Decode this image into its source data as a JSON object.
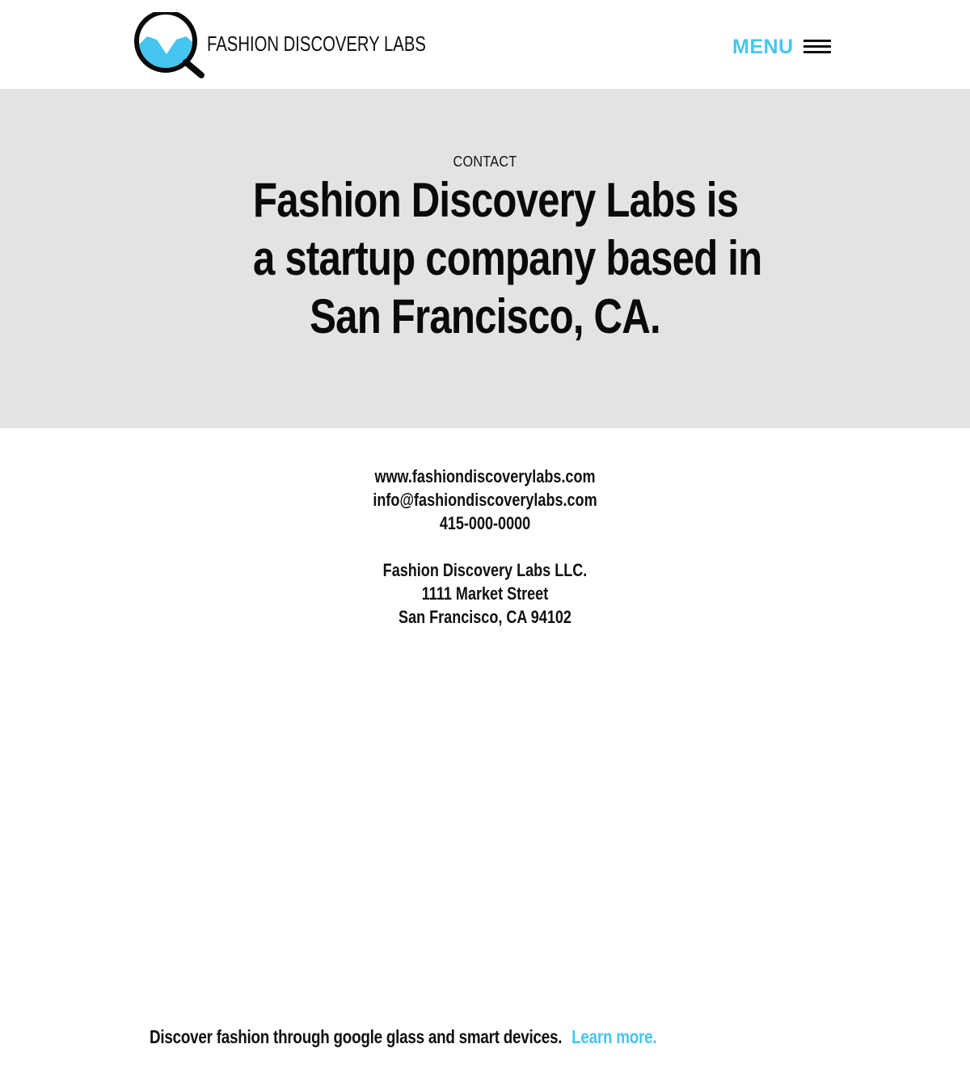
{
  "header": {
    "logo_text": "FASHION DISCOVERY LABS",
    "menu_label": "MENU"
  },
  "hero": {
    "eyebrow": "CONTACT",
    "headline_lines": [
      "Fashion Discovery Labs is",
      "a startup company based in",
      "San Francisco, CA."
    ]
  },
  "contact": {
    "website": "www.fashiondiscoverylabs.com",
    "email": "info@fashiondiscoverylabs.com",
    "phone": "415-000-0000",
    "company": "Fashion Discovery Labs LLC.",
    "street": "1111 Market Street",
    "city": "San Francisco, CA 94102"
  },
  "footer": {
    "tagline": "Discover fashion through google glass and smart devices.",
    "learn_more": "Learn more."
  },
  "colors": {
    "accent": "#45c6f0",
    "hero_bg": "#e3e3e3",
    "text": "#111111"
  },
  "icons": {
    "logo_mark": "magnifier-shirt-icon",
    "menu": "hamburger-icon"
  }
}
